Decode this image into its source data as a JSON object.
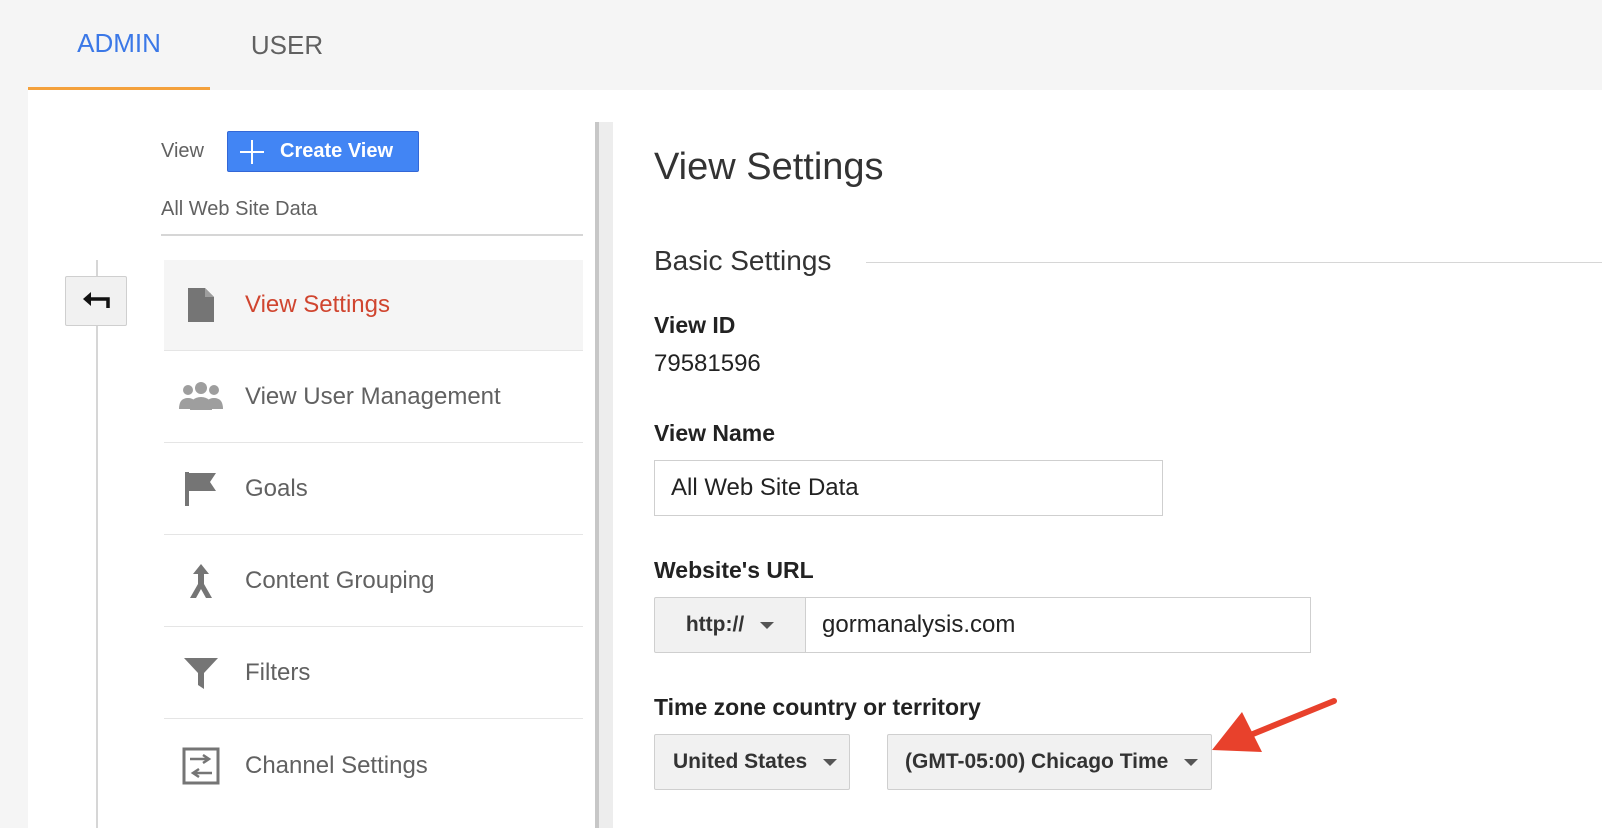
{
  "tabs": [
    {
      "label": "ADMIN",
      "active": true
    },
    {
      "label": "USER",
      "active": false
    }
  ],
  "sidebar": {
    "view_label": "View",
    "create_view_label": "Create View",
    "selected_view": "All Web Site Data",
    "items": [
      {
        "label": "View Settings",
        "icon": "document-icon",
        "active": true
      },
      {
        "label": "View User Management",
        "icon": "users-icon",
        "active": false
      },
      {
        "label": "Goals",
        "icon": "flag-icon",
        "active": false
      },
      {
        "label": "Content Grouping",
        "icon": "content-grouping-icon",
        "active": false
      },
      {
        "label": "Filters",
        "icon": "filter-icon",
        "active": false
      },
      {
        "label": "Channel Settings",
        "icon": "channel-settings-icon",
        "active": false
      }
    ]
  },
  "main": {
    "title": "View Settings",
    "section": "Basic Settings",
    "view_id_label": "View ID",
    "view_id": "79581596",
    "view_name_label": "View Name",
    "view_name": "All Web Site Data",
    "url_label": "Website's URL",
    "url_protocol": "http://",
    "url_value": "gormanalysis.com",
    "timezone_label": "Time zone country or territory",
    "timezone_country": "United States",
    "timezone_value": "(GMT-05:00) Chicago Time"
  },
  "colors": {
    "accent_blue": "#4285f4",
    "active_tab_underline": "#f4a13c",
    "active_nav_text": "#d0452f",
    "annotation_arrow": "#e8412c"
  }
}
